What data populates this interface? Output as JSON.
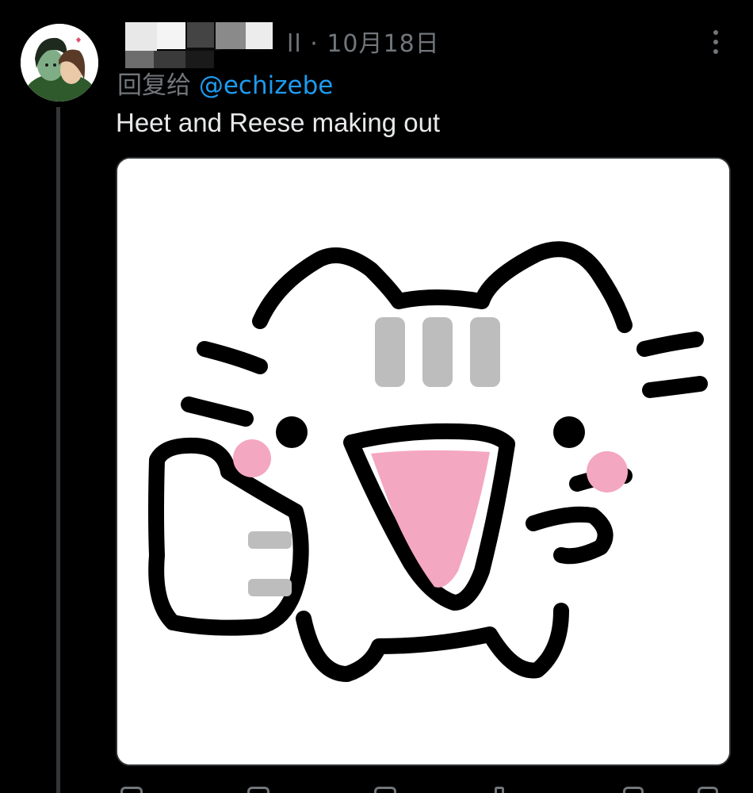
{
  "tweet": {
    "handle_tail": "ll",
    "separator": "·",
    "date": "10月18日",
    "reply_prefix": "回复给",
    "reply_mention": "@echizebe",
    "text": "Heet and Reese making out",
    "media_alt": "cat-meme-image"
  },
  "colors": {
    "background": "#000000",
    "text": "#e7e9ea",
    "muted": "#71767b",
    "link": "#1d9bf0",
    "thread_line": "#333639"
  }
}
